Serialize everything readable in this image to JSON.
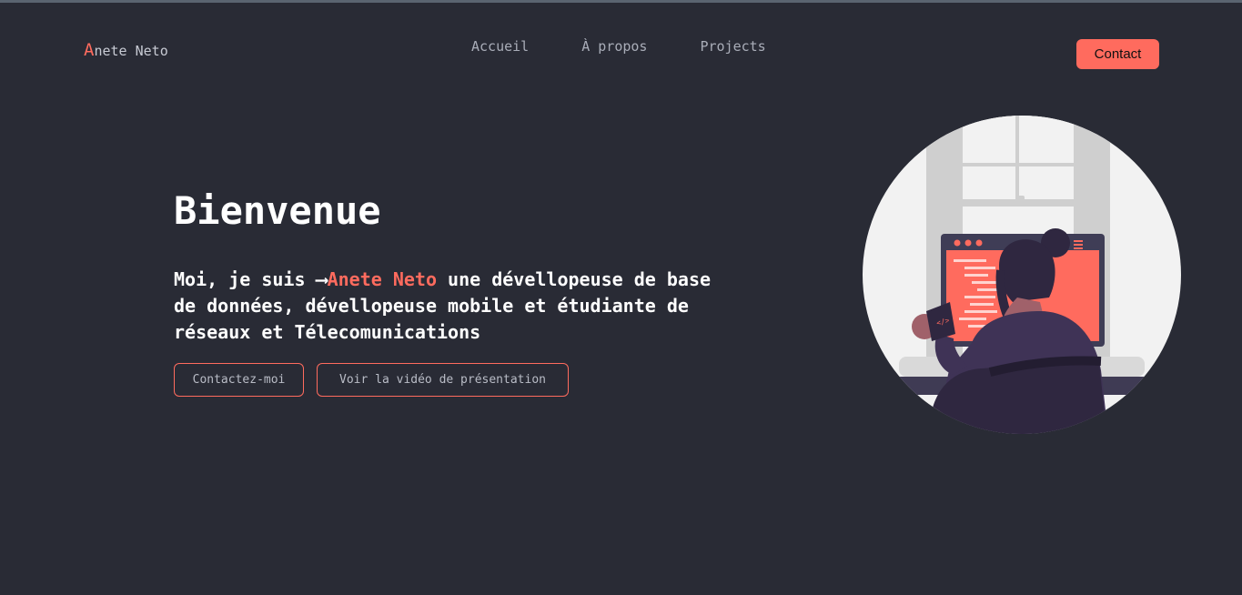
{
  "header": {
    "logo_initial": "A",
    "logo_rest": "nete Neto",
    "nav": [
      "Accueil",
      "À propos",
      "Projects"
    ],
    "contact_label": "Contact"
  },
  "hero": {
    "title": "Bienvenue",
    "intro_prefix": "Moi, je suis ⟶",
    "intro_name": "Anete Neto",
    "intro_suffix": " une dévellopeuse de base de données, dévellopeuse mobile et étudiante de réseaux et Télecomunications",
    "btn_contact": "Contactez-moi",
    "btn_video": "Voir la vidéo de présentation"
  },
  "illustration": {
    "code_tag": "</>",
    "colors": {
      "accent": "#ff6b5e",
      "dark": "#2f2740",
      "circle_bg": "#f2f2f2"
    }
  }
}
